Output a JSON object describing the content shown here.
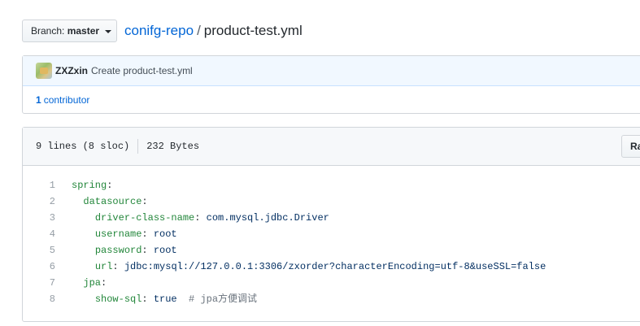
{
  "branch": {
    "prefix": "Branch:",
    "name": "master"
  },
  "breadcrumb": {
    "repo": "conifg-repo",
    "separator": "/",
    "file": "product-test.yml"
  },
  "commit": {
    "author": "ZXZxin",
    "message": "Create product-test.yml"
  },
  "contributors": {
    "count": "1",
    "label": "contributor"
  },
  "file_info": {
    "lines": "9 lines (8 sloc)",
    "size": "232 Bytes",
    "raw_label": "Raw"
  },
  "code_lines": [
    {
      "num": "1",
      "indent": "",
      "key": "spring",
      "colon": ":",
      "value": "",
      "comment": ""
    },
    {
      "num": "2",
      "indent": "  ",
      "key": "datasource",
      "colon": ":",
      "value": "",
      "comment": ""
    },
    {
      "num": "3",
      "indent": "    ",
      "key": "driver-class-name",
      "colon": ": ",
      "value": "com.mysql.jdbc.Driver",
      "comment": ""
    },
    {
      "num": "4",
      "indent": "    ",
      "key": "username",
      "colon": ": ",
      "value": "root",
      "comment": ""
    },
    {
      "num": "5",
      "indent": "    ",
      "key": "password",
      "colon": ": ",
      "value": "root",
      "comment": ""
    },
    {
      "num": "6",
      "indent": "    ",
      "key": "url",
      "colon": ": ",
      "value": "jdbc:mysql://127.0.0.1:3306/zxorder?characterEncoding=utf-8&useSSL=false",
      "comment": ""
    },
    {
      "num": "7",
      "indent": "  ",
      "key": "jpa",
      "colon": ":",
      "value": "",
      "comment": ""
    },
    {
      "num": "8",
      "indent": "    ",
      "key": "show-sql",
      "colon": ": ",
      "value": "true",
      "comment": "  # jpa方便调试"
    }
  ]
}
